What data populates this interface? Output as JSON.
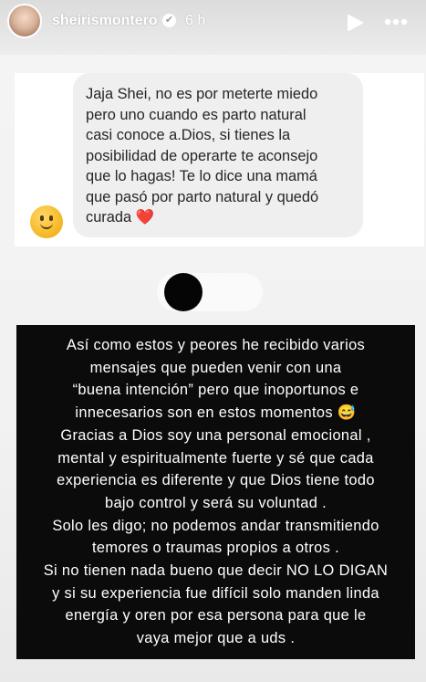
{
  "header": {
    "username": "sheirismontero",
    "verified_icon": "verified-badge",
    "time_ago": "6 h",
    "play_icon": "play-icon",
    "more_icon": "more-dots-icon"
  },
  "message": {
    "lines": [
      "Jaja Shei, no es por meterte miedo",
      "pero uno cuando es parto natural",
      "casi conoce a.Dios, si tienes la",
      "posibilidad de operarte te aconsejo",
      "que lo hagas! Te lo dice una mamá",
      "que pasó por parto natural y quedó",
      "curada ❤️"
    ],
    "sender_emoji": "upside-down-face-emoji",
    "heart_emoji": "❤️"
  },
  "toggle": {
    "state": "off"
  },
  "caption": {
    "lines": [
      "Así como estos y peores he recibido varios",
      "mensajes que pueden venir con una",
      "“buena intención”  pero que inoportunos e",
      "innecesarios son en estos momentos 😅",
      "Gracias a Dios soy una personal emocional ,",
      "mental y espiritualmente fuerte y sé que cada",
      "experiencia es diferente y que Dios tiene todo",
      "bajo control y será su voluntad .",
      "Solo les digo; no podemos andar transmitiendo",
      "temores o traumas propios a otros .",
      "Si no tienen nada bueno que decir NO LO DIGAN",
      "y si su experiencia fue difícil solo manden linda",
      "energía y oren por esa persona para que le",
      "vaya mejor que a uds ."
    ]
  },
  "colors": {
    "panel_bg": "#0b0b0b",
    "bubble_bg": "#efefef",
    "page_bg": "#f2f2f2"
  }
}
